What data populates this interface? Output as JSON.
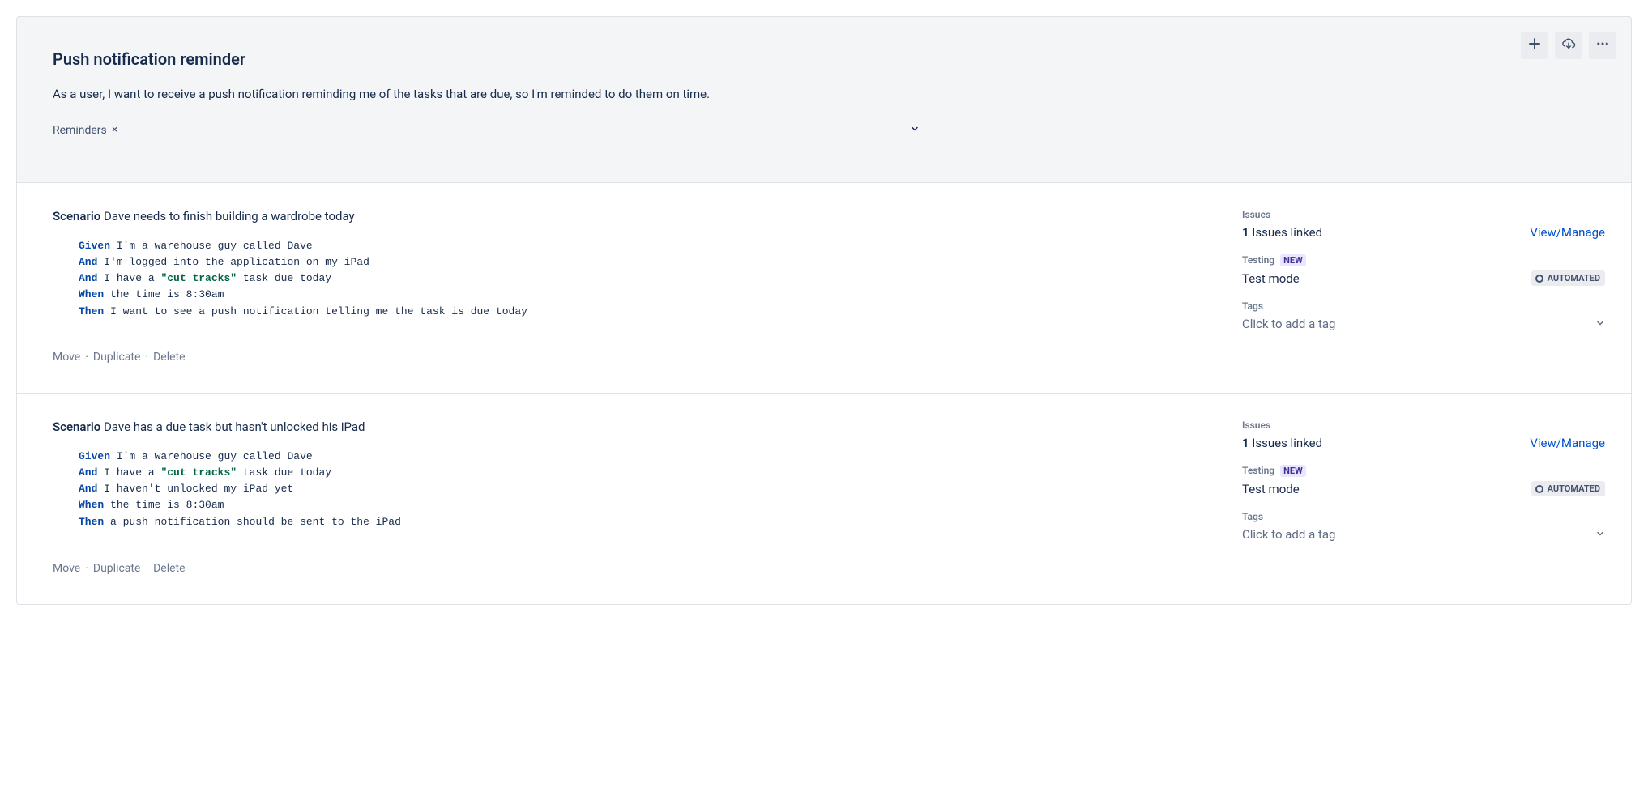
{
  "header": {
    "title": "Push notification reminder",
    "description": "As a user, I want to receive a push notification reminding me of the tasks that are due, so I'm reminded to do them on time.",
    "tag": "Reminders"
  },
  "labels": {
    "scenario_kw": "Scenario",
    "issues": "Issues",
    "testing": "Testing",
    "tags": "Tags",
    "new_badge": "NEW",
    "automated_badge": "AUTOMATED",
    "view_manage": "View/Manage",
    "test_mode": "Test mode",
    "tag_placeholder": "Click to add a tag",
    "move": "Move",
    "duplicate": "Duplicate",
    "delete": "Delete"
  },
  "scenarios": [
    {
      "title": "Dave needs to finish building a wardrobe today",
      "issues_count": "1",
      "issues_linked_suffix": " Issues linked",
      "steps": [
        {
          "kw": "Given",
          "parts": [
            "I'm a warehouse guy called Dave"
          ]
        },
        {
          "kw": "And",
          "parts": [
            "I'm logged into the application on my iPad"
          ]
        },
        {
          "kw": "And",
          "parts": [
            "I have a ",
            {
              "str": "\"cut tracks\""
            },
            " task due today"
          ]
        },
        {
          "kw": "When",
          "parts": [
            "the time is 8:30am"
          ]
        },
        {
          "kw": "Then",
          "parts": [
            "I want to see a push notification telling me the task is due today"
          ]
        }
      ]
    },
    {
      "title": "Dave has a due task but hasn't unlocked his iPad",
      "issues_count": "1",
      "issues_linked_suffix": " Issues linked",
      "steps": [
        {
          "kw": "Given",
          "parts": [
            "I'm a warehouse guy called Dave"
          ]
        },
        {
          "kw": "And",
          "parts": [
            "I have a ",
            {
              "str": "\"cut tracks\""
            },
            " task due today"
          ]
        },
        {
          "kw": "And",
          "parts": [
            "I haven't unlocked my iPad yet"
          ]
        },
        {
          "kw": "When",
          "parts": [
            "the time is 8:30am"
          ]
        },
        {
          "kw": "Then",
          "parts": [
            "a push notification should be sent to the iPad"
          ]
        }
      ]
    }
  ]
}
